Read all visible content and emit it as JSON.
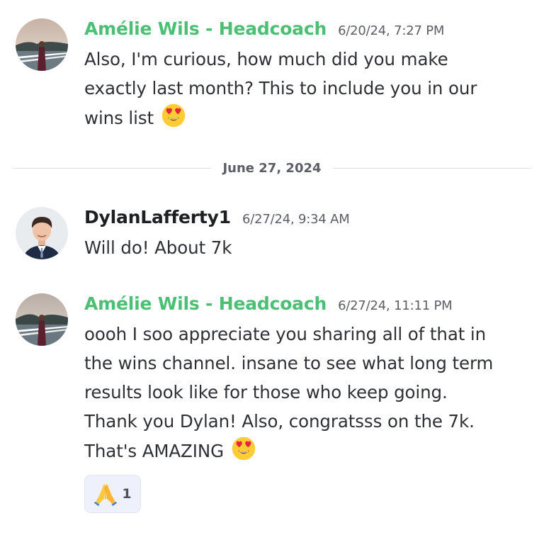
{
  "messages": [
    {
      "author": "Amélie Wils - Headcoach",
      "timestamp": "6/20/24, 7:27 PM",
      "lines": [
        "Also, I'm curious, how much did you make",
        "exactly last month? This to include you in our",
        "wins list"
      ],
      "emoji": "heart-eyes-emoji"
    },
    {
      "author": "DylanLafferty1",
      "timestamp": "6/27/24, 9:34 AM",
      "lines": [
        "Will do! About 7k"
      ]
    },
    {
      "author": "Amélie Wils - Headcoach",
      "timestamp": "6/27/24, 11:11 PM",
      "lines": [
        "oooh I soo appreciate you sharing all of that in",
        "the wins channel. insane to see what long term",
        "results look like for those who keep going.",
        "Thank you Dylan! Also, congratsss on the 7k.",
        "That's AMAZING"
      ],
      "emoji": "heart-eyes-emoji",
      "reaction": {
        "emoji": "folded-hands-emoji",
        "count": "1"
      }
    }
  ],
  "divider": {
    "label": "June 27, 2024"
  },
  "colors": {
    "coach_name": "#4cbf74",
    "user_name": "#1e1f22",
    "timestamp": "#5c5e66",
    "reaction_bg": "#eef1fb"
  }
}
